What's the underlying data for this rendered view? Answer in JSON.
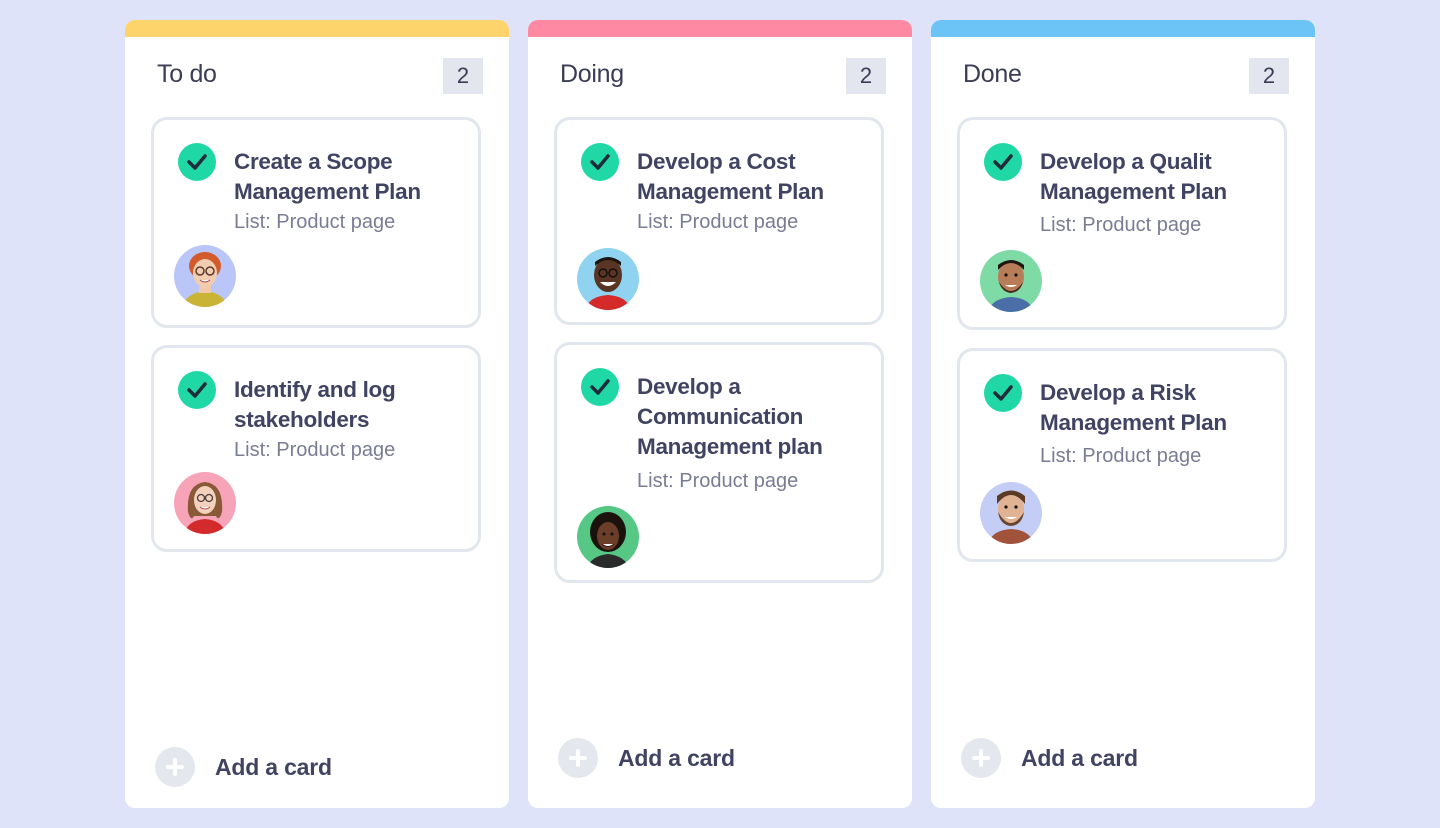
{
  "colors": {
    "background": "#dfe3fa",
    "todo_accent": "#fdd36b",
    "doing_accent": "#fd8aa2",
    "done_accent": "#6cc3f5",
    "check": "#1fd8a6"
  },
  "columns": [
    {
      "title": "To do",
      "count": "2",
      "add_label": "Add a card",
      "cards": [
        {
          "title": "Create a Scope Management Plan",
          "list": "List: Product page",
          "avatar": "woman-red-hair-glasses"
        },
        {
          "title": "Identify and log stakeholders",
          "list": "List: Product page",
          "avatar": "woman-long-hair"
        }
      ]
    },
    {
      "title": "Doing",
      "count": "2",
      "add_label": "Add a card",
      "cards": [
        {
          "title": "Develop a Cost Management Plan",
          "list": "List: Product page",
          "avatar": "man-glasses-smiling"
        },
        {
          "title": "Develop a Communication Management plan",
          "list": "List: Product page",
          "avatar": "woman-curly-hair"
        }
      ]
    },
    {
      "title": "Done",
      "count": "2",
      "add_label": "Add a card",
      "cards": [
        {
          "title": "Develop a Qualit Management Plan",
          "list": "List: Product page",
          "avatar": "man-beard-smiling"
        },
        {
          "title": "Develop a Risk Management Plan",
          "list": "List: Product page",
          "avatar": "man-beard"
        }
      ]
    }
  ]
}
